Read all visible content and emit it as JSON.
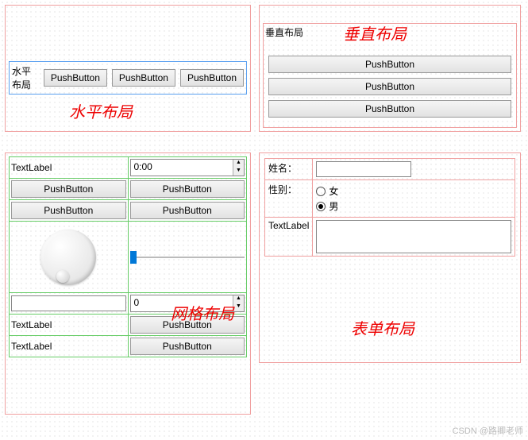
{
  "watermark": "CSDN @路卿老师",
  "horizontal": {
    "label": "水平布局",
    "annotation": "水平布局",
    "buttons": [
      "PushButton",
      "PushButton",
      "PushButton"
    ]
  },
  "vertical": {
    "label": "垂直布局",
    "annotation": "垂直布局",
    "buttons": [
      "PushButton",
      "PushButton",
      "PushButton"
    ]
  },
  "grid": {
    "annotation": "网格布局",
    "textlabel": "TextLabel",
    "timeedit": "0:00",
    "buttons": [
      "PushButton",
      "PushButton",
      "PushButton",
      "PushButton"
    ],
    "lineedit": "",
    "spinbox": "0",
    "row6_label": "TextLabel",
    "row6_button": "PushButton",
    "row7_label": "TextLabel",
    "row7_button": "PushButton"
  },
  "form": {
    "annotation": "表单布局",
    "name_label": "姓名：",
    "name_value": "",
    "gender_label": "性别：",
    "gender_female": "女",
    "gender_male": "男",
    "textlabel": "TextLabel",
    "textarea": ""
  }
}
